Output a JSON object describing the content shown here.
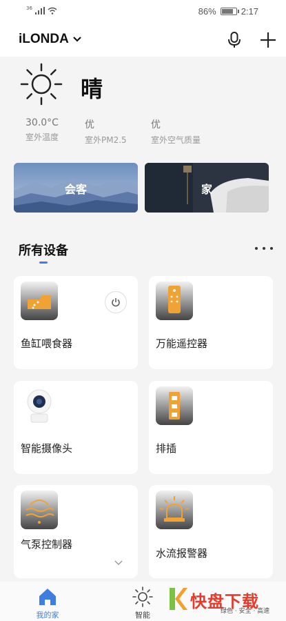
{
  "status_bar": {
    "signal": "36",
    "battery": "86%",
    "battery_level": 0.86,
    "time": "2:17"
  },
  "header": {
    "home_name": "iLONDA"
  },
  "weather": {
    "condition": "晴",
    "stats": [
      {
        "value": "30.0°C",
        "label": "室外温度"
      },
      {
        "value": "优",
        "label": "室外PM2.5"
      },
      {
        "value": "优",
        "label": "室外空气质量"
      }
    ]
  },
  "scenes": [
    {
      "label": "会客"
    },
    {
      "label": "家"
    }
  ],
  "section": {
    "title": "所有设备"
  },
  "devices": [
    {
      "name": "鱼缸喂食器",
      "icon": "fish-feeder-icon"
    },
    {
      "name": "万能遥控器",
      "icon": "remote-control-icon"
    },
    {
      "name": "智能摄像头",
      "icon": "camera-icon"
    },
    {
      "name": "排插",
      "icon": "power-strip-icon"
    },
    {
      "name": "气泵控制器",
      "icon": "air-pump-icon"
    },
    {
      "name": "水流报警器",
      "icon": "alarm-icon"
    }
  ],
  "nav": {
    "items": [
      {
        "label": "我的家",
        "icon": "home-icon"
      },
      {
        "label": "智能",
        "icon": "sun-icon"
      }
    ],
    "accent": "#3f7de0"
  },
  "watermark": {
    "brand": "快盘下载",
    "slogan": "绿色 · 安全 · 高速"
  }
}
